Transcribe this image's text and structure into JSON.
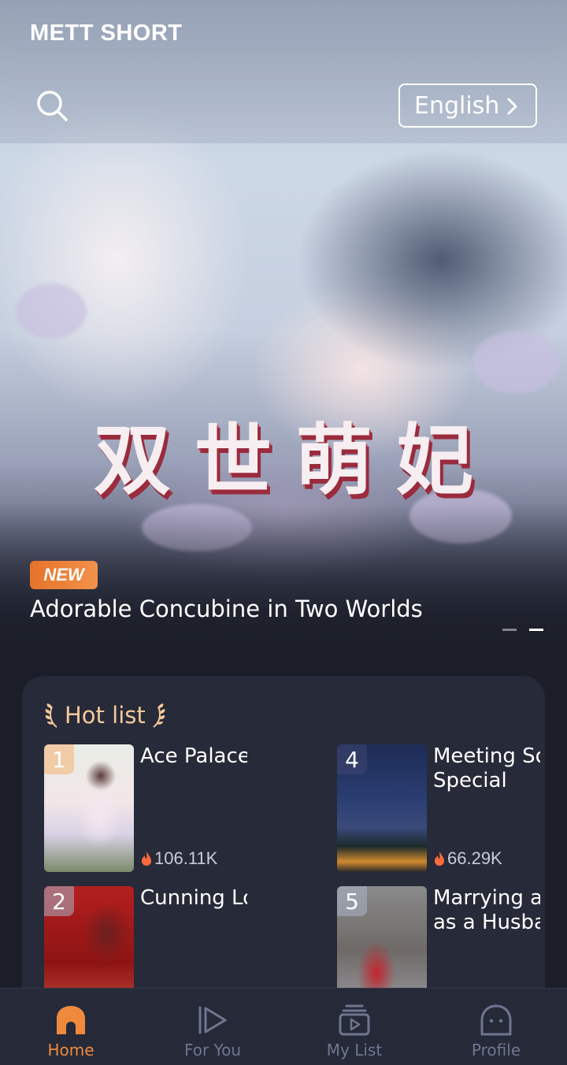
{
  "header": {
    "brand": "METT SHORT",
    "language_label": "English"
  },
  "hero": {
    "poster_title": [
      "双",
      "世",
      "萌",
      "妃"
    ],
    "badge": "NEW",
    "caption": "Adorable Concubine in Two Worlds",
    "carousel_count": 2,
    "active_slide": 2
  },
  "hot_list": {
    "title": "Hot list",
    "items": [
      {
        "rank": "1",
        "name": "Ace Palace Maid",
        "views": "106.11K"
      },
      {
        "rank": "2",
        "name": "Cunning Love",
        "views": ""
      },
      {
        "rank": "4",
        "name": "Meeting Someone Special",
        "name_lines": [
          "Meeting So",
          "Special"
        ],
        "views": "66.29K"
      },
      {
        "rank": "5",
        "name": "Marrying a ... as a Husband",
        "name_lines": [
          "Marrying a",
          "as a Husba"
        ],
        "views": ""
      }
    ]
  },
  "bottom_nav": {
    "items": [
      {
        "label": "Home",
        "icon": "home-icon",
        "active": true
      },
      {
        "label": "For You",
        "icon": "play-icon",
        "active": false
      },
      {
        "label": "My List",
        "icon": "mylist-icon",
        "active": false
      },
      {
        "label": "Profile",
        "icon": "profile-icon",
        "active": false
      }
    ]
  },
  "colors": {
    "accent": "#ef8a3c",
    "background": "#1b1e29",
    "card": "#272a38",
    "hot_title": "#f4c99b"
  }
}
